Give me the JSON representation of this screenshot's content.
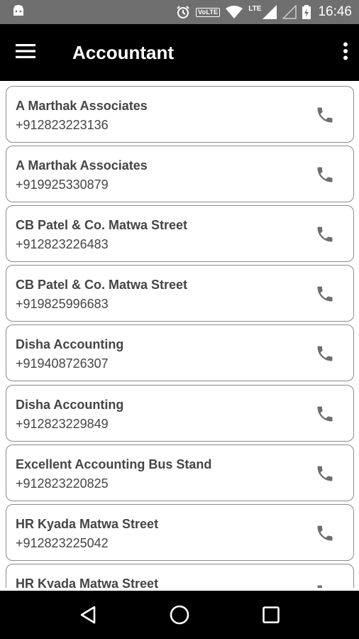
{
  "status_bar": {
    "volte": "VoLTE",
    "lte": "LTE",
    "time": "16:46"
  },
  "app_bar": {
    "title": "Accountant"
  },
  "contacts": [
    {
      "name": "A Marthak Associates",
      "phone": "+912823223136"
    },
    {
      "name": "A Marthak Associates",
      "phone": "+919925330879"
    },
    {
      "name": "CB Patel & Co. Matwa Street",
      "phone": "+912823226483"
    },
    {
      "name": "CB Patel & Co. Matwa Street",
      "phone": "+919825996683"
    },
    {
      "name": "Disha Accounting",
      "phone": "+919408726307"
    },
    {
      "name": "Disha Accounting",
      "phone": "+912823229849"
    },
    {
      "name": "Excellent Accounting Bus Stand",
      "phone": "+912823220825"
    },
    {
      "name": "HR Kyada Matwa Street",
      "phone": "+912823225042"
    },
    {
      "name": "HR Kyada Matwa Street",
      "phone": ""
    }
  ],
  "colors": {
    "status_bar": "#6f6f6f",
    "app_bar": "#000000",
    "card_border": "#8a8a8a",
    "text": "#454545",
    "call_icon": "#6e6e6e"
  },
  "icons": {
    "status_left": "android-icon",
    "alarm": "alarm-clock-icon",
    "wifi": "wifi-icon",
    "signal": "cell-signal-icon",
    "battery": "battery-charging-icon",
    "menu": "hamburger-menu-icon",
    "more": "more-vert-icon",
    "call": "phone-icon",
    "back": "back-triangle-icon",
    "home": "home-circle-icon",
    "recents": "recents-square-icon"
  }
}
